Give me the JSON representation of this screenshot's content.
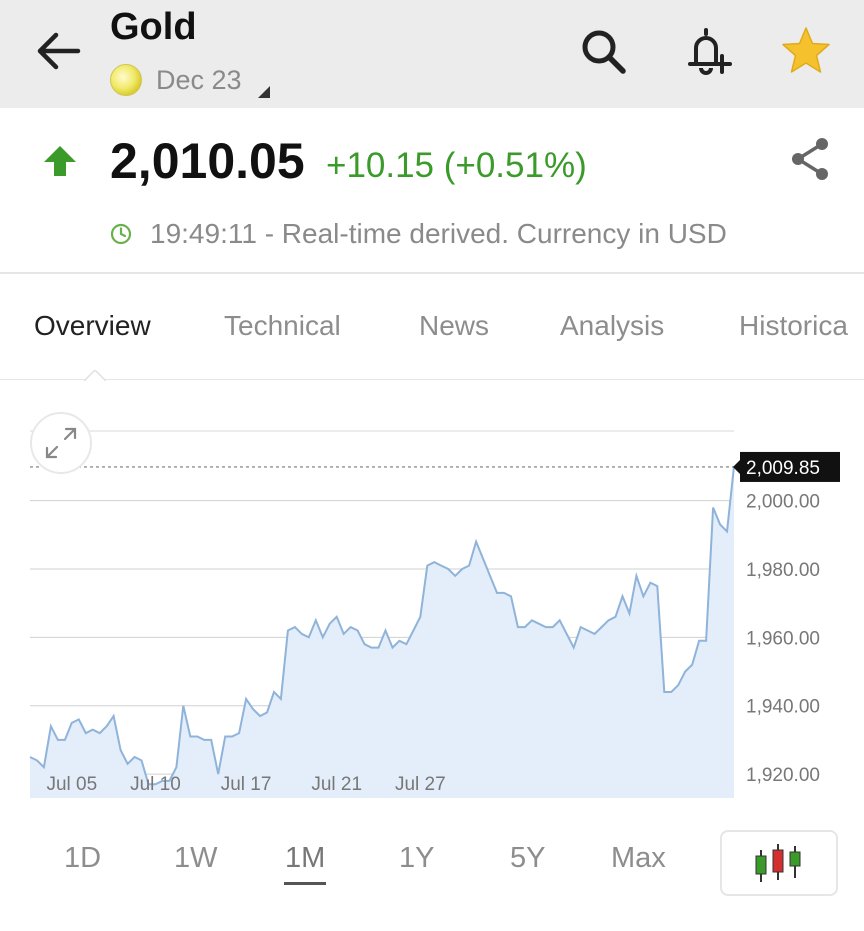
{
  "header": {
    "title": "Gold",
    "contract": "Dec 23",
    "icons": {
      "back": "arrow-left-icon",
      "search": "search-icon",
      "alert": "bell-plus-icon",
      "favorite": "star-icon"
    },
    "star_color": "#f5c12c"
  },
  "quote": {
    "price": "2,010.05",
    "change": "+10.15 (+0.51%)",
    "time_info": "19:49:11 - Real-time derived. Currency in USD",
    "up_color": "#3a9a2a"
  },
  "tabs": [
    "Overview",
    "Technical",
    "News",
    "Analysis",
    "Historica"
  ],
  "active_tab": "Overview",
  "ranges": [
    "1D",
    "1W",
    "1M",
    "1Y",
    "5Y",
    "Max"
  ],
  "active_range": "1M",
  "chart_data": {
    "type": "area",
    "last_value_label": "2,009.85",
    "last_value": 2009.85,
    "y_ticks": [
      "2,000.00",
      "1,980.00",
      "1,960.00",
      "1,940.00",
      "1,920.00"
    ],
    "y_tick_values": [
      2000,
      1980,
      1960,
      1940,
      1920
    ],
    "x_ticks": [
      "Jul 05",
      "Jul 10",
      "Jul 17",
      "Jul 21",
      "Jul 27"
    ],
    "x_tick_index": [
      6,
      18,
      31,
      44,
      56
    ],
    "ylim": [
      1913,
      2023
    ],
    "grid": true,
    "line_color": "#8fb3d9",
    "fill_color": "#e3eefa",
    "values": [
      1925,
      1924,
      1922,
      1934,
      1930,
      1930,
      1935,
      1936,
      1932,
      1933,
      1932,
      1934,
      1937,
      1927,
      1923,
      1925,
      1924,
      1917,
      1917,
      1918,
      1918,
      1922,
      1940,
      1931,
      1931,
      1930,
      1930,
      1920,
      1931,
      1931,
      1932,
      1942,
      1939,
      1937,
      1938,
      1944,
      1942,
      1962,
      1963,
      1961,
      1960,
      1965,
      1960,
      1964,
      1966,
      1961,
      1963,
      1962,
      1958,
      1957,
      1957,
      1962,
      1957,
      1959,
      1958,
      1962,
      1966,
      1981,
      1982,
      1981,
      1980,
      1978,
      1980,
      1981,
      1988,
      1983,
      1978,
      1973,
      1973,
      1972,
      1963,
      1963,
      1965,
      1964,
      1963,
      1963,
      1965,
      1961,
      1957,
      1963,
      1962,
      1961,
      1963,
      1965,
      1966,
      1972,
      1967,
      1978,
      1972,
      1976,
      1975,
      1944,
      1944,
      1946,
      1950,
      1952,
      1959,
      1959,
      1998,
      1993,
      1991,
      2010
    ]
  }
}
